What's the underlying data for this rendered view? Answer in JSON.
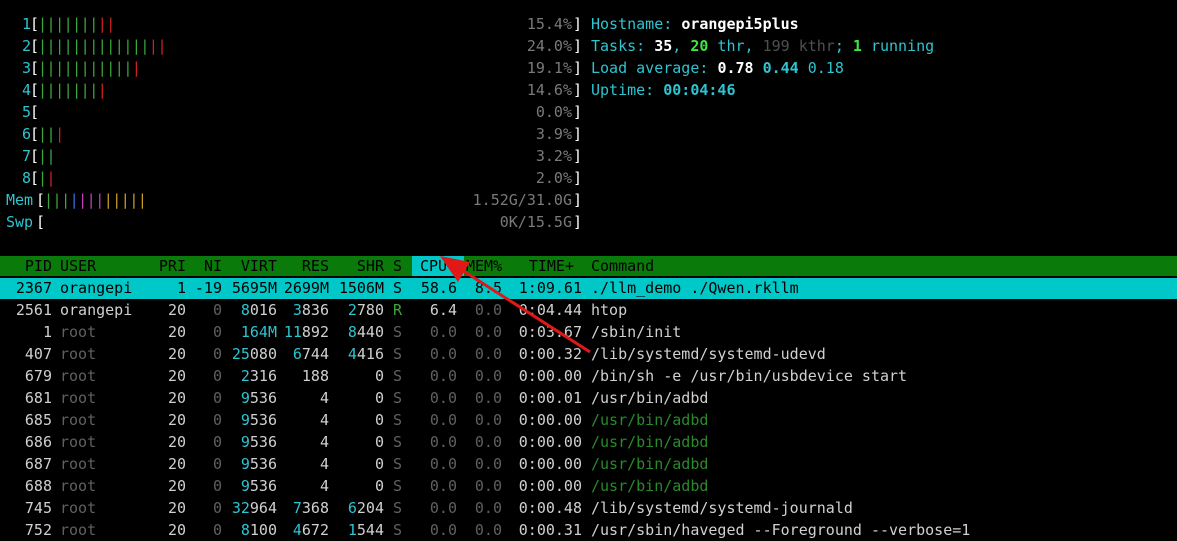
{
  "cpu_meters": [
    {
      "num": "1",
      "value": "15.4%",
      "fraction": 0.154,
      "ticks": "gggggggrr"
    },
    {
      "num": "2",
      "value": "24.0%",
      "fraction": 0.24,
      "ticks": "gggggggggggggrr"
    },
    {
      "num": "3",
      "value": "19.1%",
      "fraction": 0.191,
      "ticks": "gggggggggggr"
    },
    {
      "num": "4",
      "value": "14.6%",
      "fraction": 0.146,
      "ticks": "gggggggr"
    },
    {
      "num": "5",
      "value": "0.0%",
      "fraction": 0.0,
      "ticks": ""
    },
    {
      "num": "6",
      "value": "3.9%",
      "fraction": 0.039,
      "ticks": "ggr"
    },
    {
      "num": "7",
      "value": "3.2%",
      "fraction": 0.032,
      "ticks": "gg"
    },
    {
      "num": "8",
      "value": "2.0%",
      "fraction": 0.02,
      "ticks": "gr"
    }
  ],
  "mem": {
    "label": "Mem",
    "value": "1.52G/31.0G",
    "ticks": "gggbmmmyyyyy"
  },
  "swp": {
    "label": "Swp",
    "value": "0K/15.5G",
    "ticks": ""
  },
  "info": {
    "hostname_label": "Hostname: ",
    "hostname": "orangepi5plus",
    "tasks_label": "Tasks: ",
    "tasks": "35",
    "sep1": ", ",
    "thr": "20",
    "thr_label": " thr",
    "sep2": ", ",
    "kthr": "199 kthr",
    "sep3": "; ",
    "running": "1",
    "running_label": " running",
    "load_label": "Load average: ",
    "load1": "0.78",
    "load5": "0.44",
    "load15": "0.18",
    "uptime_label": "Uptime: ",
    "uptime": "00:04:46"
  },
  "columns": {
    "pid": "PID",
    "user": "USER",
    "pri": "PRI",
    "ni": "NI",
    "virt": "VIRT",
    "res": "RES",
    "shr": "SHR",
    "s": "S",
    "cpu": "CPU%▽",
    "mem": "MEM%",
    "time": "TIME+",
    "command": "Command"
  },
  "processes": [
    {
      "pid": "2367",
      "user": "orangepi",
      "pri": "1",
      "ni": "-19",
      "virt": "5695M",
      "res": "2699M",
      "shr": "1506M",
      "s": "S",
      "cpu": "58.6",
      "mem": "8.5",
      "time": "1:09.61",
      "command": "./llm_demo ./Qwen.rkllm"
    },
    {
      "pid": "2561",
      "user": "orangepi",
      "pri": "20",
      "ni": "0",
      "virt": "8016",
      "res": "3836",
      "shr": "2780",
      "s": "R",
      "cpu": "6.4",
      "mem": "0.0",
      "time": "0:04.44",
      "command": "htop"
    },
    {
      "pid": "1",
      "user": "root",
      "pri": "20",
      "ni": "0",
      "virt": "164M",
      "res": "11892",
      "shr": "8440",
      "s": "S",
      "cpu": "0.0",
      "mem": "0.0",
      "time": "0:03.67",
      "command": "/sbin/init"
    },
    {
      "pid": "407",
      "user": "root",
      "pri": "20",
      "ni": "0",
      "virt": "25080",
      "res": "6744",
      "shr": "4416",
      "s": "S",
      "cpu": "0.0",
      "mem": "0.0",
      "time": "0:00.32",
      "command": "/lib/systemd/systemd-udevd"
    },
    {
      "pid": "679",
      "user": "root",
      "pri": "20",
      "ni": "0",
      "virt": "2316",
      "res": "188",
      "shr": "0",
      "s": "S",
      "cpu": "0.0",
      "mem": "0.0",
      "time": "0:00.00",
      "command": "/bin/sh -e /usr/bin/usbdevice start"
    },
    {
      "pid": "681",
      "user": "root",
      "pri": "20",
      "ni": "0",
      "virt": "9536",
      "res": "4",
      "shr": "0",
      "s": "S",
      "cpu": "0.0",
      "mem": "0.0",
      "time": "0:00.01",
      "command": "/usr/bin/adbd"
    },
    {
      "pid": "685",
      "user": "root",
      "pri": "20",
      "ni": "0",
      "virt": "9536",
      "res": "4",
      "shr": "0",
      "s": "S",
      "cpu": "0.0",
      "mem": "0.0",
      "time": "0:00.00",
      "command": "/usr/bin/adbd"
    },
    {
      "pid": "686",
      "user": "root",
      "pri": "20",
      "ni": "0",
      "virt": "9536",
      "res": "4",
      "shr": "0",
      "s": "S",
      "cpu": "0.0",
      "mem": "0.0",
      "time": "0:00.00",
      "command": "/usr/bin/adbd"
    },
    {
      "pid": "687",
      "user": "root",
      "pri": "20",
      "ni": "0",
      "virt": "9536",
      "res": "4",
      "shr": "0",
      "s": "S",
      "cpu": "0.0",
      "mem": "0.0",
      "time": "0:00.00",
      "command": "/usr/bin/adbd"
    },
    {
      "pid": "688",
      "user": "root",
      "pri": "20",
      "ni": "0",
      "virt": "9536",
      "res": "4",
      "shr": "0",
      "s": "S",
      "cpu": "0.0",
      "mem": "0.0",
      "time": "0:00.00",
      "command": "/usr/bin/adbd"
    },
    {
      "pid": "745",
      "user": "root",
      "pri": "20",
      "ni": "0",
      "virt": "32964",
      "res": "7368",
      "shr": "6204",
      "s": "S",
      "cpu": "0.0",
      "mem": "0.0",
      "time": "0:00.48",
      "command": "/lib/systemd/systemd-journald"
    },
    {
      "pid": "752",
      "user": "root",
      "pri": "20",
      "ni": "0",
      "virt": "8100",
      "res": "4672",
      "shr": "1544",
      "s": "S",
      "cpu": "0.0",
      "mem": "0.0",
      "time": "0:00.31",
      "command": "/usr/sbin/haveged --Foreground --verbose=1"
    }
  ],
  "colors": {
    "header_bg": "#0a7a0a",
    "selected_bg": "#00c8c8",
    "arrow": "#e01818",
    "accent": "#2ec4d0"
  }
}
